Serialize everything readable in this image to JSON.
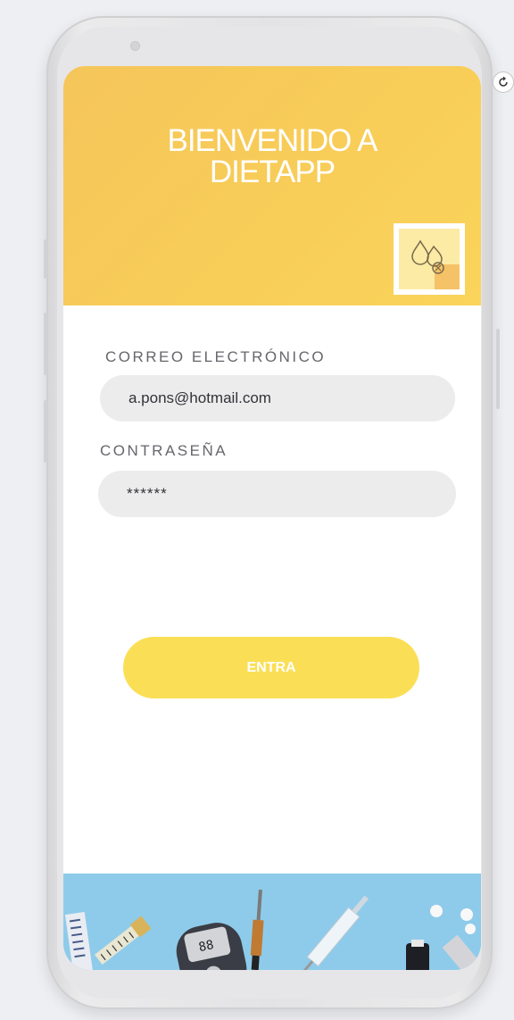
{
  "app": {
    "title": "BIENVENIDO A\nDIETAPP"
  },
  "form": {
    "email_label": "CORREO ELECTRÓNICO",
    "email_value": "a.pons@hotmail.com",
    "password_label": "CONTRASEÑA",
    "password_value": "******",
    "submit_label": "ENTRA"
  },
  "icons": {
    "logo": "drops-logo-icon",
    "rotate": "rotate-icon",
    "footer": "diabetes-supplies-photo"
  },
  "colors": {
    "header": "#f8cd58",
    "button": "#fadf56",
    "field": "#ececed",
    "footer": "#8ecbea"
  }
}
